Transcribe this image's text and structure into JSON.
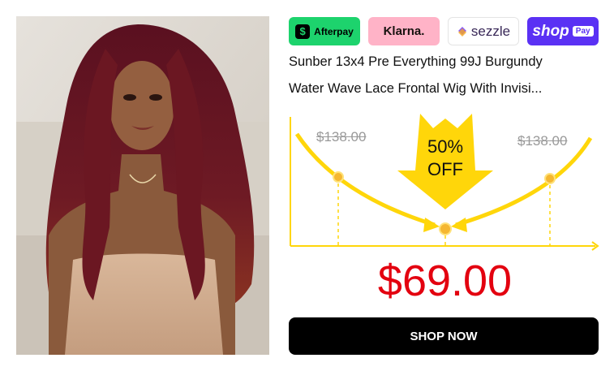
{
  "payments": {
    "afterpay": {
      "label": "Afterpay",
      "icon": "afterpay-icon",
      "color": "#1dd36d"
    },
    "klarna": {
      "label": "Klarna.",
      "color": "#ffb3c7"
    },
    "sezzle": {
      "label": "sezzle",
      "icon": "sezzle-icon",
      "color": "#382757"
    },
    "shop_pay": {
      "label": "shop",
      "badge": "Pay",
      "color": "#5a31f4"
    }
  },
  "product": {
    "title_line1": "Sunber 13x4 Pre Everything 99J Burgundy",
    "title_line2": "Water Wave Lace Frontal Wig With Invisi...",
    "photo": "model-wearing-burgundy-curly-wig"
  },
  "promo": {
    "old_price_left": "$138.00",
    "old_price_right": "$138.00",
    "discount_line1": "50%",
    "discount_line2": "OFF",
    "accent_color": "#ffd60a"
  },
  "price": "$69.00",
  "price_color": "#e3000f",
  "cta": {
    "label": "SHOP NOW"
  }
}
